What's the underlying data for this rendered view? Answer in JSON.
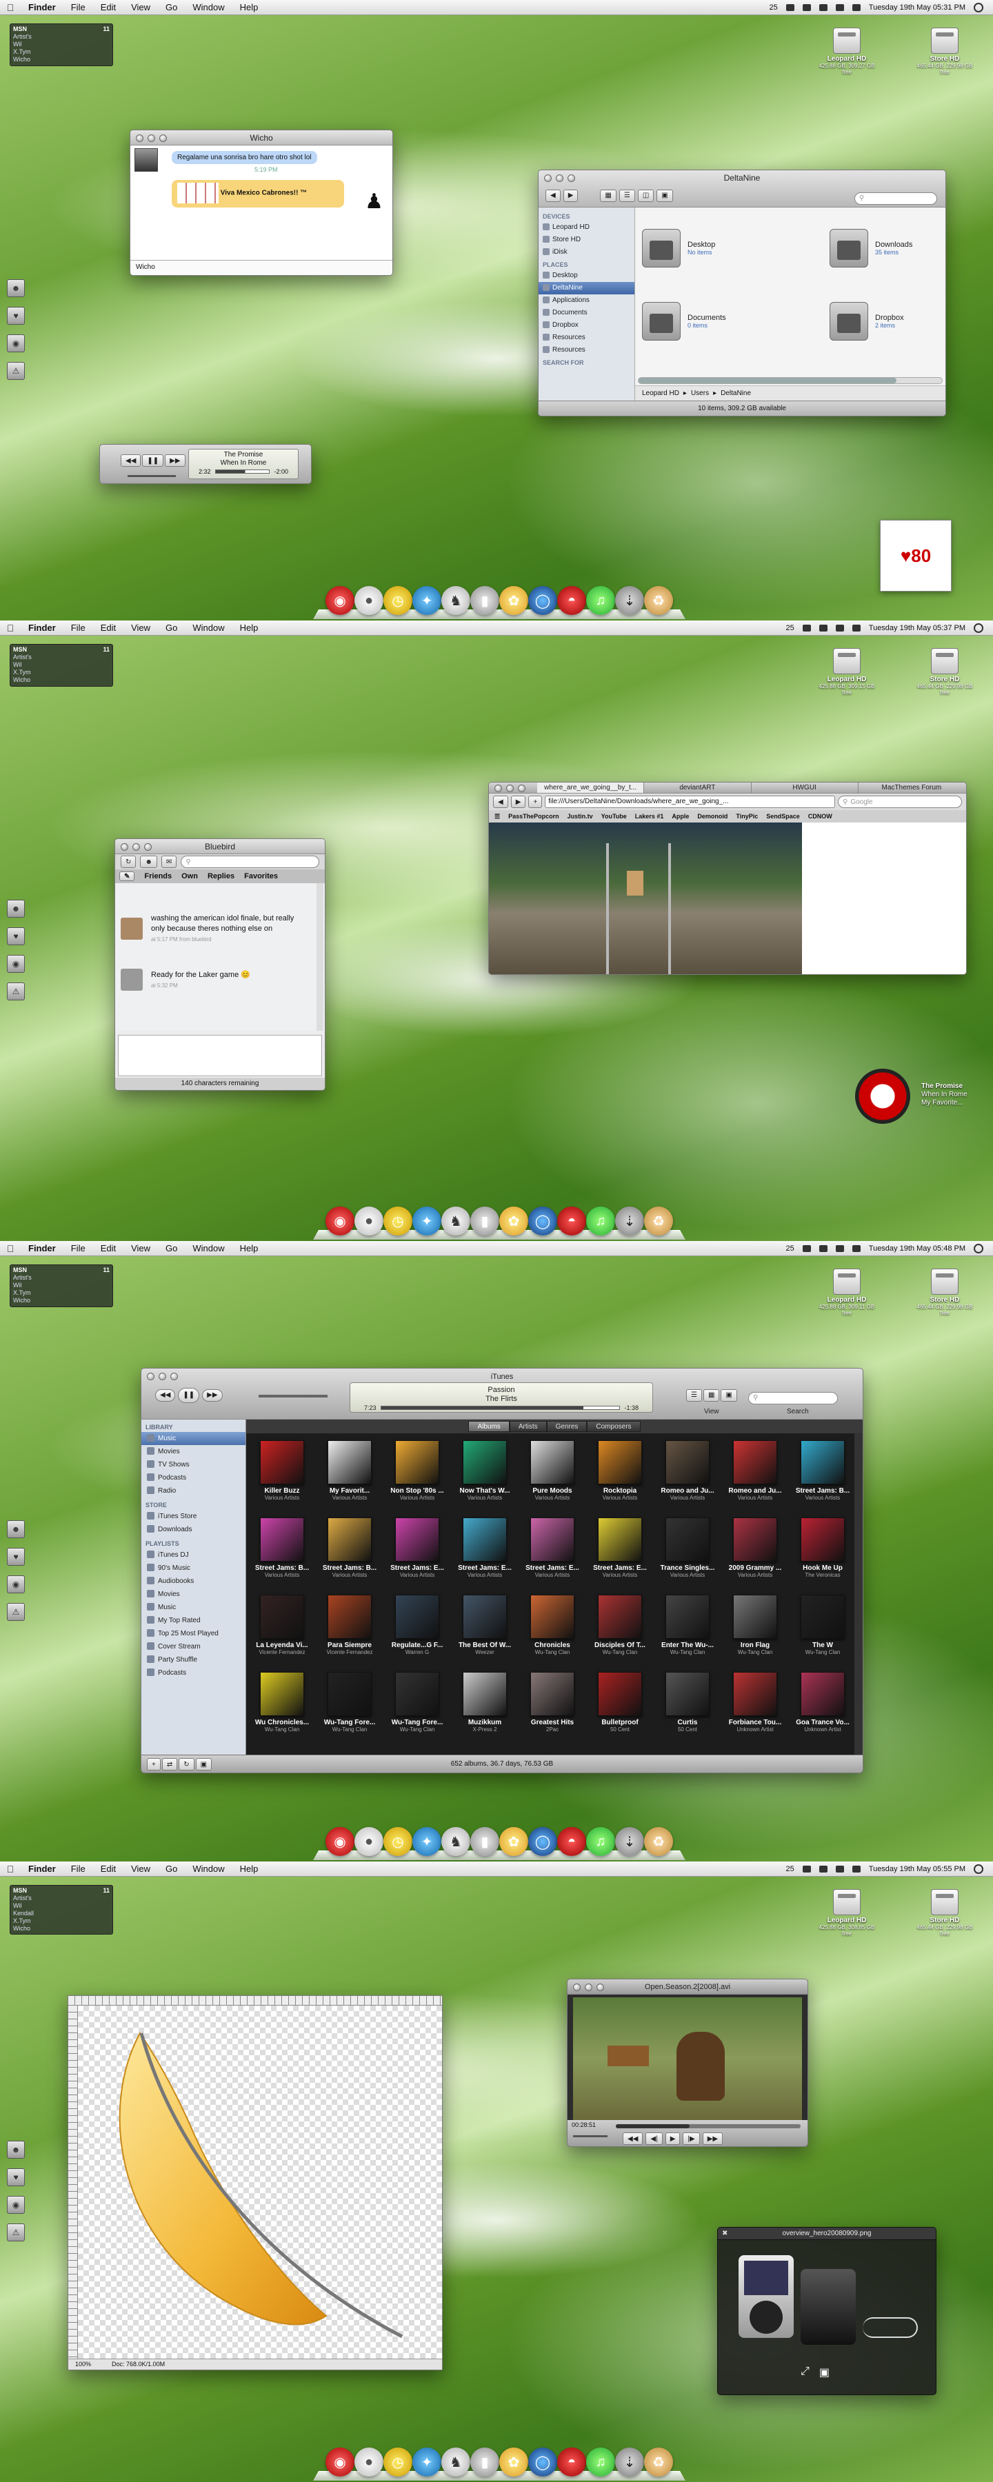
{
  "menubar": {
    "app": "Finder",
    "items": [
      "File",
      "Edit",
      "View",
      "Go",
      "Window",
      "Help"
    ],
    "battery_label": "25"
  },
  "clocks": [
    "Tuesday 19th May  05:31 PM",
    "Tuesday 19th May  05:37 PM",
    "Tuesday 19th May  05:48 PM",
    "Tuesday 19th May  05:55 PM"
  ],
  "drives": [
    {
      "name": "Leopard HD",
      "sub": [
        "425.88 GB, 309.27 GB free",
        "425.88 GB, 309.15 GB free",
        "425.88 GB, 309.11 GB free",
        "425.88 GB, 308.85 GB free"
      ]
    },
    {
      "name": "Store HD",
      "sub": [
        "465.44 GB, 229.98 GB free",
        "465.44 GB, 229.98 GB free",
        "465.44 GB, 229.98 GB free",
        "465.44 GB, 229.98 GB free"
      ]
    }
  ],
  "msn": {
    "title": "MSN",
    "header": "Artist's",
    "contacts": [
      "Wil",
      "X.Tym",
      "Wicho"
    ],
    "contacts4": [
      "Wil",
      "Kendall",
      "X.Tym",
      "Wicho"
    ]
  },
  "screen1": {
    "chat": {
      "title": "Wicho",
      "msg1": "Regalame una sonrisa bro hare otro shot lol",
      "time1": "5:19 PM",
      "msg2": "Viva Mexico Cabrones!! ™",
      "input_label": "Wicho"
    },
    "player": {
      "track": "The Promise",
      "album": "When In Rome",
      "elapsed": "2:32",
      "remaining": "-2:00"
    },
    "finder": {
      "title": "DeltaNine",
      "devices_header": "DEVICES",
      "devices": [
        "Leopard HD",
        "Store HD",
        "iDisk"
      ],
      "places_header": "PLACES",
      "places": [
        "Desktop",
        "DeltaNine",
        "Applications",
        "Documents",
        "Dropbox",
        "Resources",
        "Resources"
      ],
      "search_header": "SEARCH FOR",
      "items": [
        {
          "name": "Desktop",
          "sub": "No items"
        },
        {
          "name": "Downloads",
          "sub": "35 items"
        },
        {
          "name": "Documents",
          "sub": "0 items"
        },
        {
          "name": "Dropbox",
          "sub": "2 items"
        }
      ],
      "path": [
        "Leopard HD",
        "Users",
        "DeltaNine"
      ],
      "status": "10 items, 309.2 GB available"
    }
  },
  "screen2": {
    "bluebird": {
      "title": "Bluebird",
      "tabs": [
        "Friends",
        "Own",
        "Replies",
        "Favorites"
      ],
      "tweet1": "washing the american idol finale, but really only because theres nothing else on",
      "tweet1_meta": "at 5:17 PM from bluebird",
      "tweet2": "Ready for the Laker game 😊",
      "tweet2_meta": "at 5:32 PM",
      "status": "140 characters remaining"
    },
    "browser": {
      "tabs": [
        "where_are_we_going__by_t...",
        "deviantART",
        "HWGUI",
        "MacThemes Forum"
      ],
      "url": "file:///Users/DeltaNine/Downloads/where_are_we_going_...",
      "search_placeholder": "Google",
      "bookmarks": [
        "PassThePopcorn",
        "Justin.tv",
        "YouTube",
        "Lakers #1",
        "Apple",
        "Demonoid",
        "TinyPic",
        "SendSpace",
        "CDNOW"
      ]
    },
    "widget": {
      "track": "The Promise",
      "album": "When In Rome",
      "artist": "My Favorite..."
    }
  },
  "screen3": {
    "itunes": {
      "title": "iTunes",
      "track": "Passion",
      "artist": "The Flirts",
      "elapsed": "7:23",
      "remaining": "-1:38",
      "view_label": "View",
      "search_label": "Search",
      "library_header": "LIBRARY",
      "library": [
        "Music",
        "Movies",
        "TV Shows",
        "Podcasts",
        "Radio"
      ],
      "store_header": "STORE",
      "store": [
        "iTunes Store",
        "Downloads"
      ],
      "playlists_header": "PLAYLISTS",
      "playlists": [
        "iTunes DJ",
        "90's Music",
        "Audiobooks",
        "Movies",
        "Music",
        "My Top Rated",
        "Top 25 Most Played",
        "Cover Stream",
        "Party Shuffle",
        "Podcasts"
      ],
      "tabs": [
        "Albums",
        "Artists",
        "Genres",
        "Composers"
      ],
      "albums": [
        {
          "t": "Killer Buzz",
          "a": "Various Artists",
          "c": "#c22"
        },
        {
          "t": "My Favorit...",
          "a": "Various Artists",
          "c": "#eee"
        },
        {
          "t": "Non Stop '80s ...",
          "a": "Various Artists",
          "c": "#ea3"
        },
        {
          "t": "Now That's W...",
          "a": "Various Artists",
          "c": "#2a7"
        },
        {
          "t": "Pure Moods",
          "a": "Various Artists",
          "c": "#ddd"
        },
        {
          "t": "Rocktopia",
          "a": "Various Artists",
          "c": "#d82"
        },
        {
          "t": "Romeo and Ju...",
          "a": "Various Artists",
          "c": "#654"
        },
        {
          "t": "Romeo and Ju...",
          "a": "Various Artists",
          "c": "#c33"
        },
        {
          "t": "Street Jams: B...",
          "a": "Various Artists",
          "c": "#3ac"
        },
        {
          "t": "Street Jams: B...",
          "a": "Various Artists",
          "c": "#c4a"
        },
        {
          "t": "Street Jams: B...",
          "a": "Various Artists",
          "c": "#da4"
        },
        {
          "t": "Street Jams: E...",
          "a": "Various Artists",
          "c": "#c4a"
        },
        {
          "t": "Street Jams: E...",
          "a": "Various Artists",
          "c": "#4ac"
        },
        {
          "t": "Street Jams: E...",
          "a": "Various Artists",
          "c": "#c6a"
        },
        {
          "t": "Street Jams: E...",
          "a": "Various Artists",
          "c": "#dc3"
        },
        {
          "t": "Trance Singles...",
          "a": "Various Artists",
          "c": "#333"
        },
        {
          "t": "2009 Grammy ...",
          "a": "Various Artists",
          "c": "#a34"
        },
        {
          "t": "Hook Me Up",
          "a": "The Veronicas",
          "c": "#b23"
        },
        {
          "t": "La Leyenda Vi...",
          "a": "Vicente Fernandez",
          "c": "#322"
        },
        {
          "t": "Para Siempre",
          "a": "Vicente Fernandez",
          "c": "#a42"
        },
        {
          "t": "Regulate...G F...",
          "a": "Warren G",
          "c": "#345"
        },
        {
          "t": "The Best Of W...",
          "a": "Weezer",
          "c": "#456"
        },
        {
          "t": "Chronicles",
          "a": "Wu-Tang Clan",
          "c": "#c63"
        },
        {
          "t": "Disciples Of T...",
          "a": "Wu-Tang Clan",
          "c": "#a33"
        },
        {
          "t": "Enter The Wu-...",
          "a": "Wu-Tang Clan",
          "c": "#444"
        },
        {
          "t": "Iron Flag",
          "a": "Wu-Tang Clan",
          "c": "#777"
        },
        {
          "t": "The W",
          "a": "Wu-Tang Clan",
          "c": "#222"
        },
        {
          "t": "Wu Chronicles...",
          "a": "Wu-Tang Clan",
          "c": "#dc2"
        },
        {
          "t": "Wu-Tang Fore...",
          "a": "Wu-Tang Clan",
          "c": "#222"
        },
        {
          "t": "Wu-Tang Fore...",
          "a": "Wu-Tang Clan",
          "c": "#333"
        },
        {
          "t": "Muzikkum",
          "a": "X-Press 2",
          "c": "#ccc"
        },
        {
          "t": "Greatest Hits",
          "a": "2Pac",
          "c": "#877"
        },
        {
          "t": "Bulletproof",
          "a": "50 Cent",
          "c": "#a22"
        },
        {
          "t": "Curtis",
          "a": "50 Cent",
          "c": "#555"
        },
        {
          "t": "Forbiance Tou...",
          "a": "Unknown Artist",
          "c": "#b33"
        },
        {
          "t": "Goa Trance Vo...",
          "a": "Unknown Artist",
          "c": "#a35"
        }
      ],
      "status": "652 albums, 36.7 days, 76.53 GB",
      "play_label": "Play"
    }
  },
  "screen4": {
    "photoshop": {
      "zoom": "100%",
      "doc": "Doc: 768.0K/1.00M"
    },
    "quicktime": {
      "title": "Open.Season.2[2008].avi",
      "time": "00:28:51"
    },
    "preview": {
      "title": "overview_hero20080909.png"
    }
  },
  "dock_icons": [
    "jar-icon",
    "mouse-icon",
    "clock-icon",
    "safari-icon",
    "penguin-icon",
    "remote-icon",
    "feather-icon",
    "globe-icon",
    "soda-icon",
    "itunes-icon",
    "finder-icon",
    "downloads-icon",
    "trash-icon"
  ],
  "colors": {
    "accent": "#3e66a8",
    "wallpaper": "#6ea33a"
  }
}
